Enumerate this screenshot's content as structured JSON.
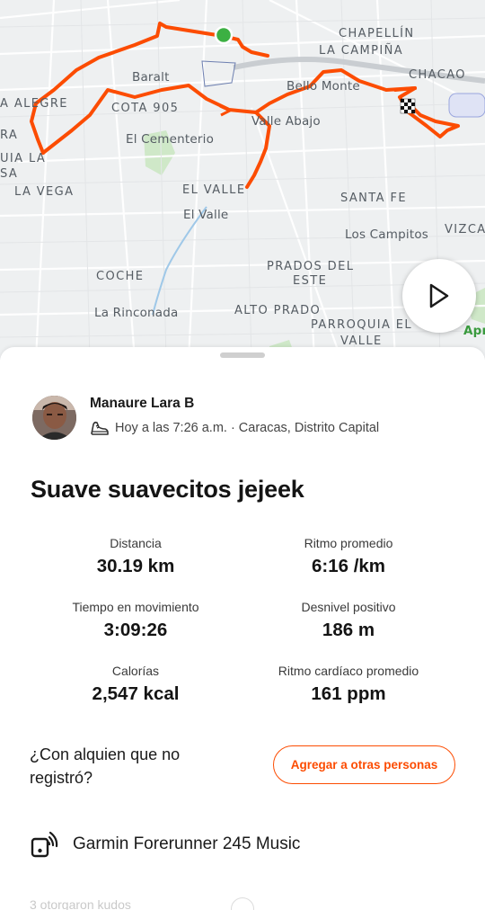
{
  "map": {
    "labels": [
      {
        "id": "chapellin",
        "text": "CHAPELLÍN",
        "caps": true
      },
      {
        "id": "la-campina",
        "text": "LA CAMPIÑA",
        "caps": true
      },
      {
        "id": "chacao",
        "text": "CHACAO",
        "caps": true
      },
      {
        "id": "baralt",
        "text": "Baralt",
        "caps": false
      },
      {
        "id": "bello-monte",
        "text": "Bello Monte",
        "caps": false
      },
      {
        "id": "alegre",
        "text": "A ALEGRE",
        "caps": true
      },
      {
        "id": "cota-905",
        "text": "COTA 905",
        "caps": true
      },
      {
        "id": "ra",
        "text": "RA",
        "caps": true
      },
      {
        "id": "valle-abajo",
        "text": "Valle Abajo",
        "caps": false
      },
      {
        "id": "el-cementerio",
        "text": "El Cementerio",
        "caps": false
      },
      {
        "id": "uia-la",
        "text": "UIA LA",
        "caps": true
      },
      {
        "id": "sa",
        "text": "SA",
        "caps": true
      },
      {
        "id": "la-vega",
        "text": "LA VEGA",
        "caps": true
      },
      {
        "id": "el-valle-caps",
        "text": "EL VALLE",
        "caps": true
      },
      {
        "id": "santa-fe",
        "text": "SANTA FE",
        "caps": true
      },
      {
        "id": "el-valle",
        "text": "El Valle",
        "caps": false
      },
      {
        "id": "los-campitos",
        "text": "Los Campitos",
        "caps": false
      },
      {
        "id": "vizca",
        "text": "VIZCA",
        "caps": true
      },
      {
        "id": "coche",
        "text": "COCHE",
        "caps": true
      },
      {
        "id": "prados-del",
        "text": "PRADOS DEL",
        "caps": true
      },
      {
        "id": "este",
        "text": "ESTE",
        "caps": true
      },
      {
        "id": "la-rinconada",
        "text": "La Rinconada",
        "caps": false
      },
      {
        "id": "alto-prado",
        "text": "ALTO PRADO",
        "caps": true
      },
      {
        "id": "parroquia-el",
        "text": "PARROQUIA EL",
        "caps": true
      },
      {
        "id": "valle",
        "text": "VALLE",
        "caps": true
      },
      {
        "id": "apr",
        "text": "Apr",
        "caps": false,
        "green": true
      }
    ],
    "route_color": "#fc4c02",
    "start_color": "#3cb043"
  },
  "athlete": {
    "name": "Manaure Lara B",
    "meta": "Hoy a las 7:26 a.m. · Caracas, Distrito Capital",
    "activity_icon": "running-shoe-icon"
  },
  "activity": {
    "title": "Suave suavecitos jejeek"
  },
  "stats": [
    {
      "label": "Distancia",
      "value": "30.19 km"
    },
    {
      "label": "Ritmo promedio",
      "value": "6:16 /km"
    },
    {
      "label": "Tiempo en movimiento",
      "value": "3:09:26"
    },
    {
      "label": "Desnivel positivo",
      "value": "186 m"
    },
    {
      "label": "Calorías",
      "value": "2,547 kcal"
    },
    {
      "label": "Ritmo cardíaco promedio",
      "value": "161 ppm"
    }
  ],
  "missing": {
    "question": "¿Con alquien que no registró?",
    "add_button": "Agregar a otras personas"
  },
  "device": {
    "icon": "watch-icon",
    "name": "Garmin Forerunner 245 Music"
  },
  "kudos": {
    "text": "3 otorgaron kudos"
  },
  "colors": {
    "accent": "#fc4c02"
  }
}
